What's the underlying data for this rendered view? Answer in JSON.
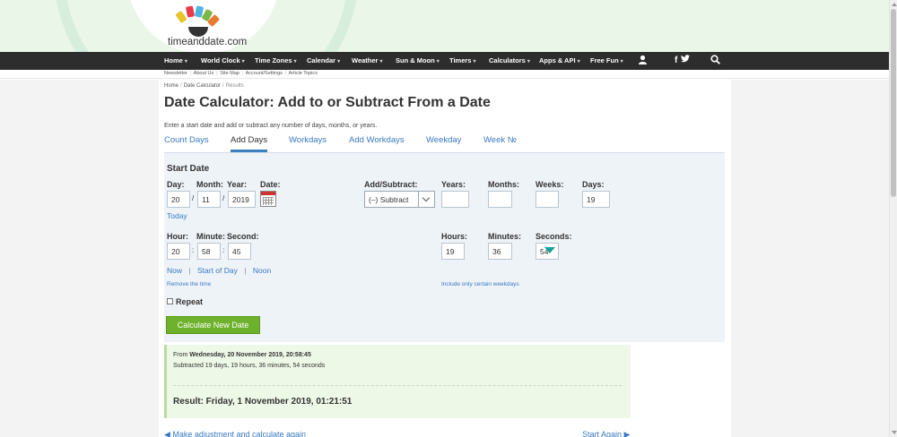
{
  "logo": {
    "text": "timeanddate.com",
    "petal_colors": [
      "#e8c32c",
      "#e83a4b",
      "#4cb5e0",
      "#7ab648",
      "#e87b2c",
      "#7d4cb5"
    ]
  },
  "nav": {
    "items": [
      {
        "label": "Home",
        "caret": "▾"
      },
      {
        "label": "World Clock",
        "caret": "▾"
      },
      {
        "label": "Time Zones",
        "caret": "▾"
      },
      {
        "label": "Calendar",
        "caret": "▾"
      },
      {
        "label": "Weather",
        "caret": "▾"
      },
      {
        "label": "Sun & Moon",
        "caret": "▾"
      },
      {
        "label": "Timers",
        "caret": "▾"
      },
      {
        "label": "Calculators",
        "caret": "▾"
      },
      {
        "label": "Apps & API",
        "caret": "▾"
      },
      {
        "label": "Free Fun",
        "caret": "▾"
      }
    ],
    "user_icon": "user-icon",
    "facebook_label": "f",
    "twitter_icon": "twitter-icon",
    "search_icon": "search-icon",
    "background_color": "#2d2d2d"
  },
  "subnav": {
    "items": [
      "Newsletter",
      "About Us",
      "Site Map",
      "Account/Settings",
      "Article Topics"
    ],
    "separator": "|"
  },
  "breadcrumb": {
    "home": "Home",
    "date_calculator": "Date Calculator",
    "current": "Results",
    "separator": "/"
  },
  "page": {
    "title": "Date Calculator: Add to or Subtract From a Date",
    "intro": "Enter a start date and add or subtract any number of days, months, or years."
  },
  "tabs": [
    {
      "label": "Count Days",
      "active": false
    },
    {
      "label": "Add Days",
      "active": true
    },
    {
      "label": "Workdays",
      "active": false
    },
    {
      "label": "Add Workdays",
      "active": false
    },
    {
      "label": "Weekday",
      "active": false
    },
    {
      "label": "Week №",
      "active": false
    }
  ],
  "form": {
    "section_title": "Start Date",
    "day_label": "Day:",
    "month_label": "Month:",
    "year_label": "Year:",
    "date_label": "Date:",
    "day_value": "20",
    "month_value": "11",
    "year_value": "2019",
    "date_separator": "/",
    "today_link": "Today",
    "hour_label": "Hour:",
    "minute_label": "Minute:",
    "second_label": "Second:",
    "hour_value": "20",
    "minute_value": "58",
    "second_value": "45",
    "time_separator": ":",
    "now_link": "Now",
    "start_of_day_link": "Start of Day",
    "noon_link": "Noon",
    "link_separator": "|",
    "remove_time_link": "Remove the time",
    "add_subtract_label": "Add/Subtract:",
    "add_subtract_value": "(–) Subtract",
    "years_label": "Years:",
    "months_label": "Months:",
    "weeks_label": "Weeks:",
    "days_label": "Days:",
    "years_value": "",
    "months_value": "",
    "weeks_value": "",
    "days_value": "19",
    "hours_label": "Hours:",
    "minutes_label": "Minutes:",
    "seconds_label": "Seconds:",
    "hours_value": "19",
    "minutes_value": "36",
    "seconds_value": "54",
    "weekdays_link": "Include only certain weekdays",
    "repeat_label": "Repeat",
    "repeat_checked": false,
    "calculate_button": "Calculate New Date",
    "button_color": "#6eb12c"
  },
  "result": {
    "from_prefix": "From",
    "from_date": "Wednesday, 20 November 2019, 20:58:45",
    "subtracted": "Subtracted 19 days, 19 hours, 36 minutes, 54 seconds",
    "final": "Result: Friday, 1 November 2019, 01:21:51"
  },
  "bottom": {
    "adjust_link": "◀ Make adjustment and calculate again",
    "start_again_link": "Start Again ▶"
  }
}
